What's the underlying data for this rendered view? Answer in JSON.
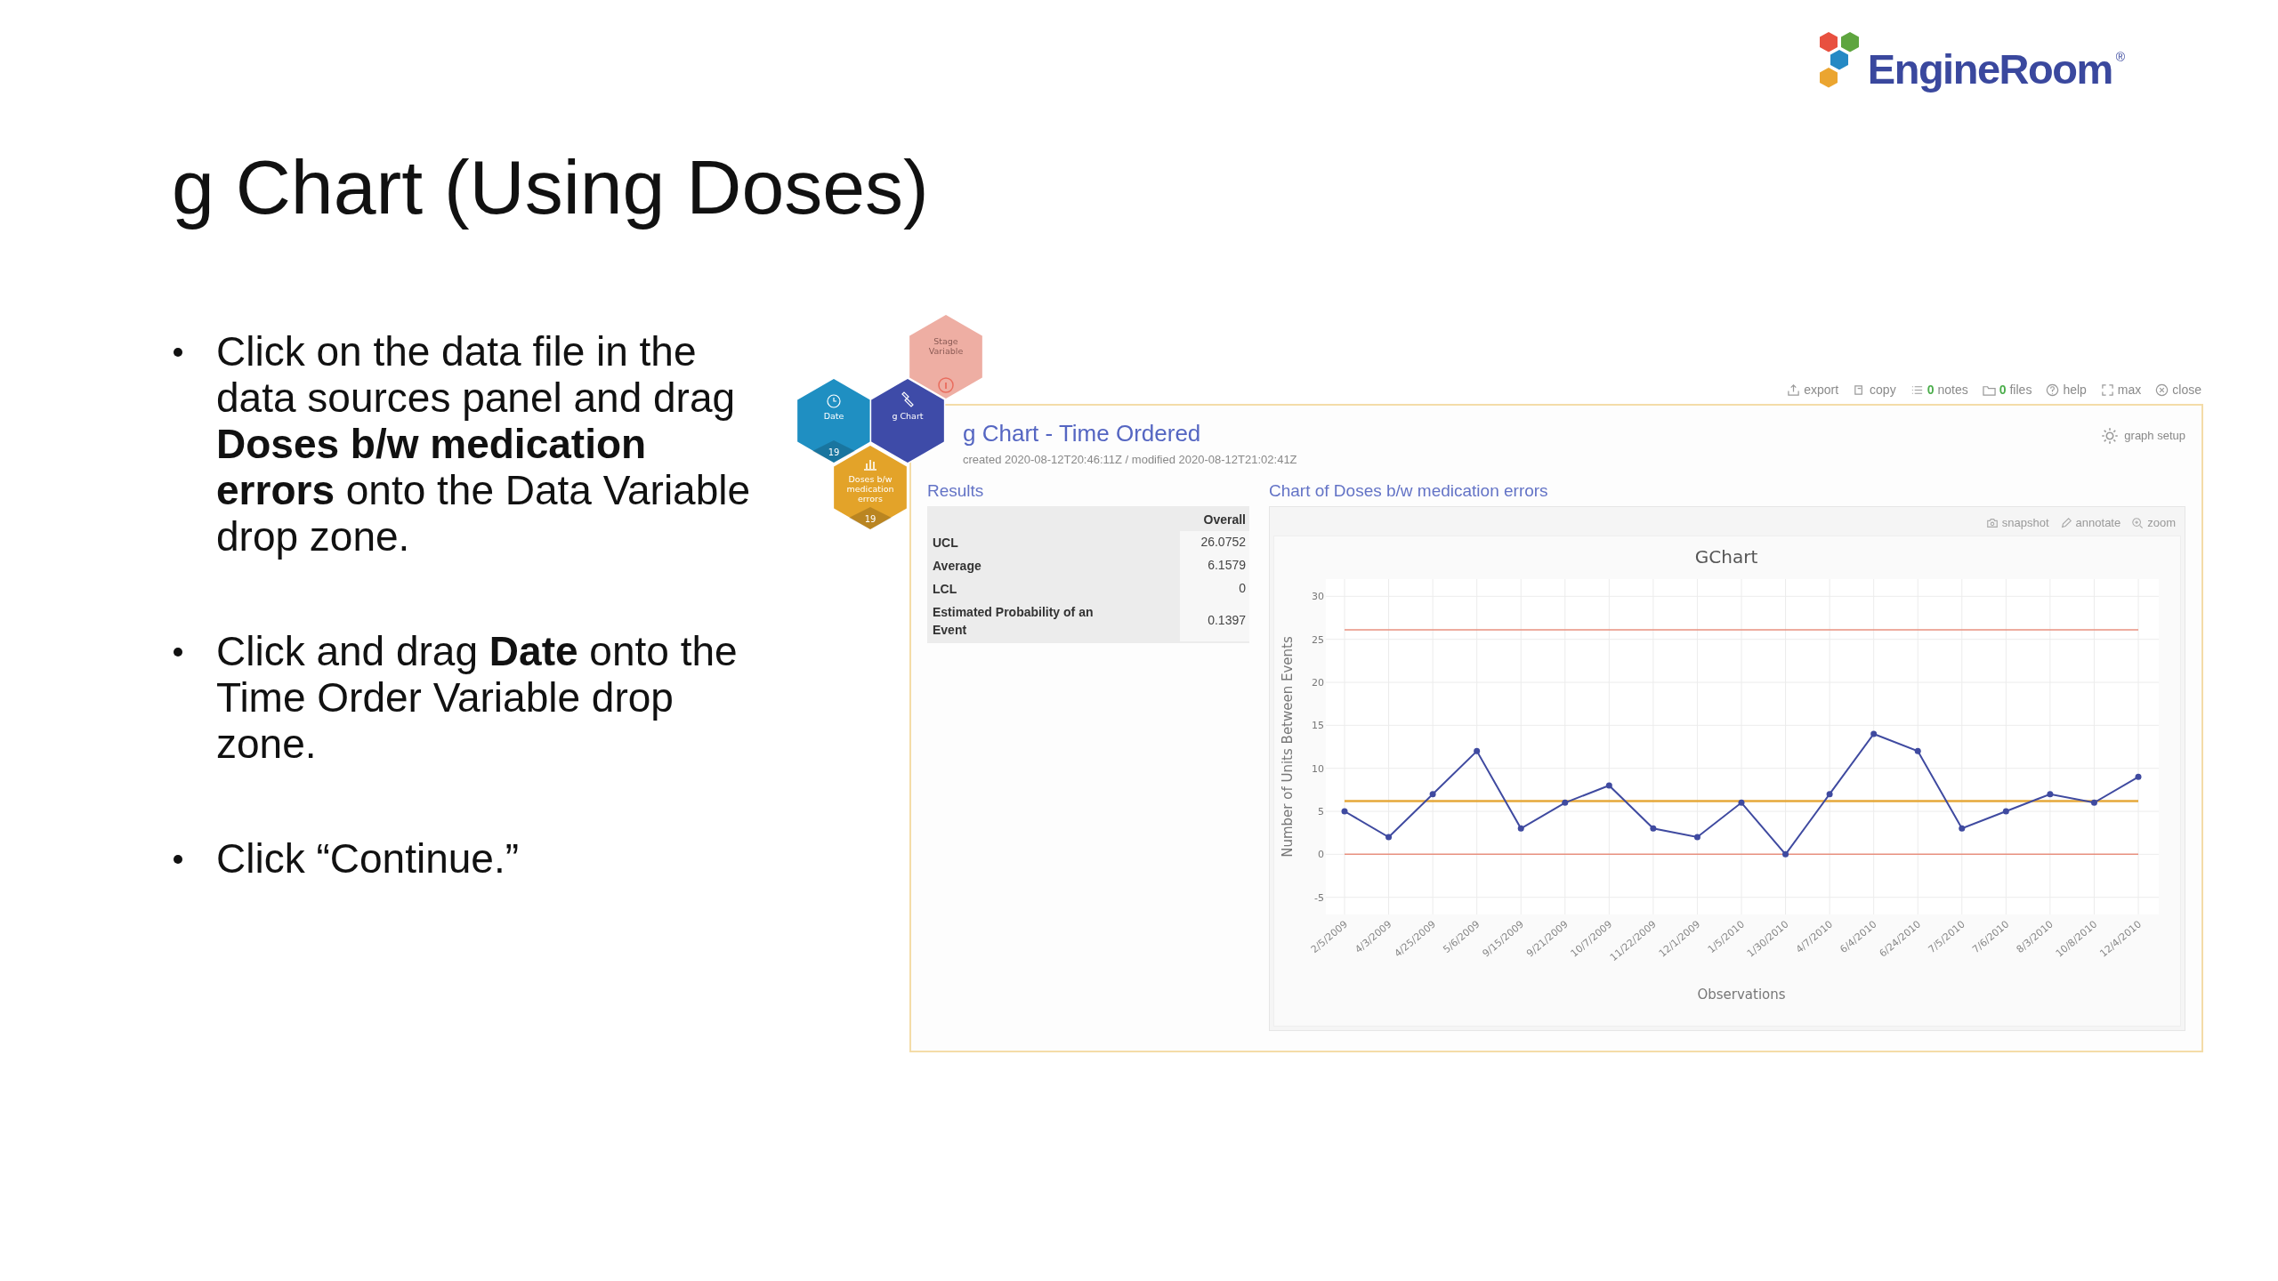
{
  "logo": {
    "text": "EngineRoom",
    "mark": "®"
  },
  "slide_title": "g Chart (Using Doses)",
  "bullets": [
    "Click on the data file in the data sources panel and drag **Doses b/w medication errors** onto the Data Variable drop zone.",
    "Click and drag **Date** onto the Time Order Variable drop zone.",
    "Click “Continue.”"
  ],
  "hexagons": [
    {
      "kind": "stage",
      "lines": [
        "Stage",
        "Variable"
      ],
      "color": "#eeaea3"
    },
    {
      "kind": "date",
      "lines": [
        "Date"
      ],
      "count": "19",
      "color": "#1f8fc2"
    },
    {
      "kind": "test",
      "lines": [
        "g Chart"
      ],
      "color": "#3e4ba8"
    },
    {
      "kind": "numeric",
      "lines": [
        "Doses b/w",
        "medication",
        "errors"
      ],
      "count": "19",
      "color": "#e3a329"
    }
  ],
  "toolbar": [
    {
      "kind": "export",
      "label": "export"
    },
    {
      "kind": "copy",
      "label": "copy"
    },
    {
      "kind": "notes",
      "count": "0",
      "label": "notes"
    },
    {
      "kind": "files",
      "count": "0",
      "label": "files"
    },
    {
      "kind": "help",
      "label": "help"
    },
    {
      "kind": "max",
      "label": "max"
    },
    {
      "kind": "close",
      "label": "close"
    }
  ],
  "panel": {
    "title": "g Chart - Time Ordered",
    "meta": "created 2020-08-12T20:46:11Z / modified 2020-08-12T21:02:41Z",
    "setup": "graph setup"
  },
  "results": {
    "heading": "Results",
    "column": "Overall",
    "rows": [
      {
        "label": "UCL",
        "value": "26.0752"
      },
      {
        "label": "Average",
        "value": "6.1579"
      },
      {
        "label": "LCL",
        "value": "0"
      },
      {
        "label": "Estimated Probability of an Event",
        "value": "0.1397"
      }
    ]
  },
  "chart_section": {
    "heading": "Chart of Doses b/w medication errors",
    "tools": [
      {
        "kind": "snapshot",
        "label": "snapshot"
      },
      {
        "kind": "annotate",
        "label": "annotate"
      },
      {
        "kind": "zoom",
        "label": "zoom"
      }
    ],
    "chart_data": {
      "type": "line",
      "title": "GChart",
      "xlabel": "Observations",
      "ylabel": "Number of Units Between Events",
      "categories": [
        "2/5/2009",
        "4/3/2009",
        "4/25/2009",
        "5/6/2009",
        "9/15/2009",
        "9/21/2009",
        "10/7/2009",
        "11/22/2009",
        "12/1/2009",
        "1/5/2010",
        "1/30/2010",
        "4/7/2010",
        "6/4/2010",
        "6/24/2010",
        "7/5/2010",
        "7/6/2010",
        "8/3/2010",
        "10/8/2010",
        "12/4/2010"
      ],
      "grid": true,
      "series": [
        {
          "color": "#3f4aa0",
          "marker": true,
          "values": [
            5,
            2,
            7,
            12,
            3,
            6,
            8,
            3,
            2,
            6,
            0,
            7,
            14,
            12,
            3,
            5,
            7,
            6,
            9
          ]
        },
        {
          "color": "#e8907f",
          "marker": false,
          "values": [
            26.1,
            26.1,
            26.1,
            26.1,
            26.1,
            26.1,
            26.1,
            26.1,
            26.1,
            26.1,
            26.1,
            26.1,
            26.1,
            26.1,
            26.1,
            26.1,
            26.1,
            26.1,
            26.1
          ]
        },
        {
          "color": "#e6a83a",
          "marker": false,
          "values": [
            6.2,
            6.2,
            6.2,
            6.2,
            6.2,
            6.2,
            6.2,
            6.2,
            6.2,
            6.2,
            6.2,
            6.2,
            6.2,
            6.2,
            6.2,
            6.2,
            6.2,
            6.2,
            6.2
          ]
        },
        {
          "color": "#e8907f",
          "marker": false,
          "values": [
            0,
            0,
            0,
            0,
            0,
            0,
            0,
            0,
            0,
            0,
            0,
            0,
            0,
            0,
            0,
            0,
            0,
            0,
            0
          ]
        }
      ],
      "ylim": [
        -7,
        32
      ],
      "yticks": [
        -5,
        0,
        5,
        10,
        15,
        20,
        25,
        30
      ]
    }
  }
}
